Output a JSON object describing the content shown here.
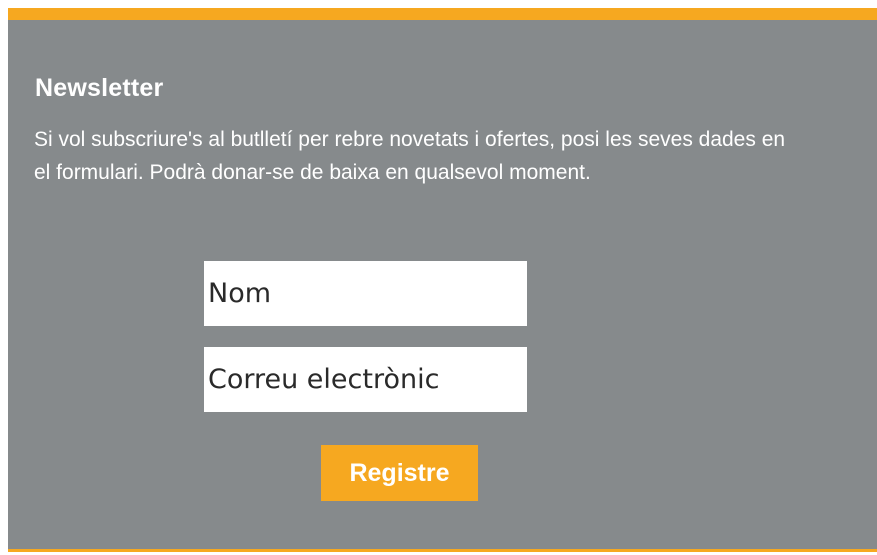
{
  "newsletter": {
    "title": "Newsletter",
    "description": "Si vol subscriure's al butlletí per rebre novetats i ofertes, posi les seves dades en el formulari. Podrà donar-se de baixa en qualsevol moment.",
    "name_placeholder": "Nom",
    "email_placeholder": "Correu electrònic",
    "submit_label": "Registre"
  },
  "colors": {
    "accent": "#f6a820",
    "panel_background": "#868a8c",
    "text": "#ffffff"
  }
}
